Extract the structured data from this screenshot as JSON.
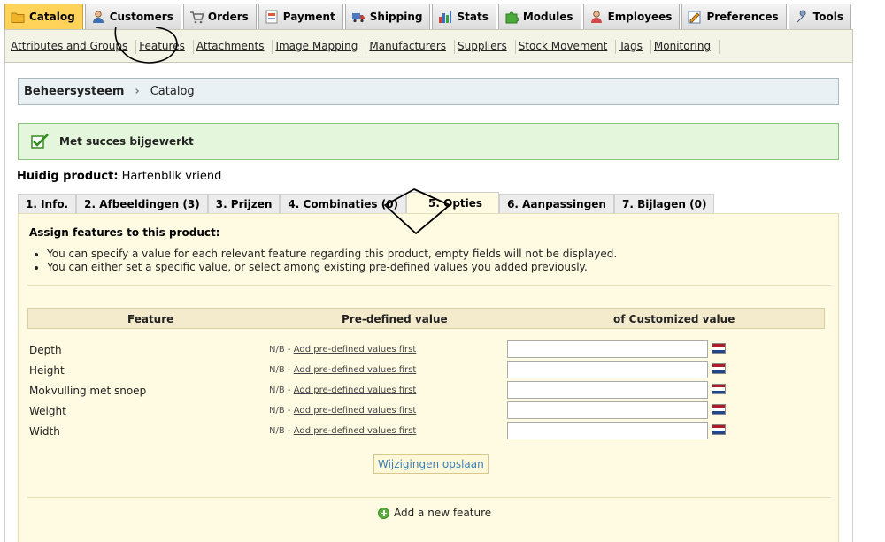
{
  "top_tabs": [
    {
      "label": "Catalog",
      "icon": "folder-icon",
      "active": true
    },
    {
      "label": "Customers",
      "icon": "user-icon",
      "active": false
    },
    {
      "label": "Orders",
      "icon": "cart-icon",
      "active": false
    },
    {
      "label": "Payment",
      "icon": "payment-icon",
      "active": false
    },
    {
      "label": "Shipping",
      "icon": "truck-icon",
      "active": false
    },
    {
      "label": "Stats",
      "icon": "chart-icon",
      "active": false
    },
    {
      "label": "Modules",
      "icon": "puzzle-icon",
      "active": false
    },
    {
      "label": "Employees",
      "icon": "employee-icon",
      "active": false
    },
    {
      "label": "Preferences",
      "icon": "preferences-icon",
      "active": false
    },
    {
      "label": "Tools",
      "icon": "wrench-icon",
      "active": false
    }
  ],
  "subnav": [
    "Attributes and Groups",
    "Features",
    "Attachments",
    "Image Mapping",
    "Manufacturers",
    "Suppliers",
    "Stock Movement",
    "Tags",
    "Monitoring"
  ],
  "breadcrumb": {
    "root": "Beheersysteem",
    "current": "Catalog"
  },
  "success_message": "Met succes bijgewerkt",
  "product": {
    "label": "Huidig product:",
    "name": "Hartenblik vriend"
  },
  "product_tabs": [
    {
      "label": "1. Info.",
      "active": false
    },
    {
      "label": "2. Afbeeldingen (3)",
      "active": false
    },
    {
      "label": "3. Prijzen",
      "active": false
    },
    {
      "label": "4. Combinaties (0)",
      "active": false
    },
    {
      "label": "5. Opties",
      "active": true
    },
    {
      "label": "6. Aanpassingen",
      "active": false
    },
    {
      "label": "7. Bijlagen (0)",
      "active": false
    }
  ],
  "panel": {
    "title": "Assign features to this product:",
    "help": [
      "You can specify a value for each relevant feature regarding this product, empty fields will not be displayed.",
      "You can either set a specific value, or select among existing pre-defined values you added previously."
    ],
    "columns": {
      "feature": "Feature",
      "predefined": "Pre-defined value",
      "custom_prefix": "of",
      "custom": "Customized value"
    },
    "na_prefix": "N/B - ",
    "na_link": "Add pre-defined values first",
    "features": [
      {
        "name": "Depth",
        "value": ""
      },
      {
        "name": "Height",
        "value": ""
      },
      {
        "name": "Mokvulling met snoep",
        "value": ""
      },
      {
        "name": "Weight",
        "value": ""
      },
      {
        "name": "Width",
        "value": ""
      }
    ],
    "save_label": "Wijzigingen opslaan",
    "add_label": "Add a new feature"
  },
  "colors": {
    "active_tab": "#ffd35a",
    "panel_bg": "#fffbe2",
    "success_bg": "#e4f7dc",
    "link": "#3a7fb8"
  }
}
